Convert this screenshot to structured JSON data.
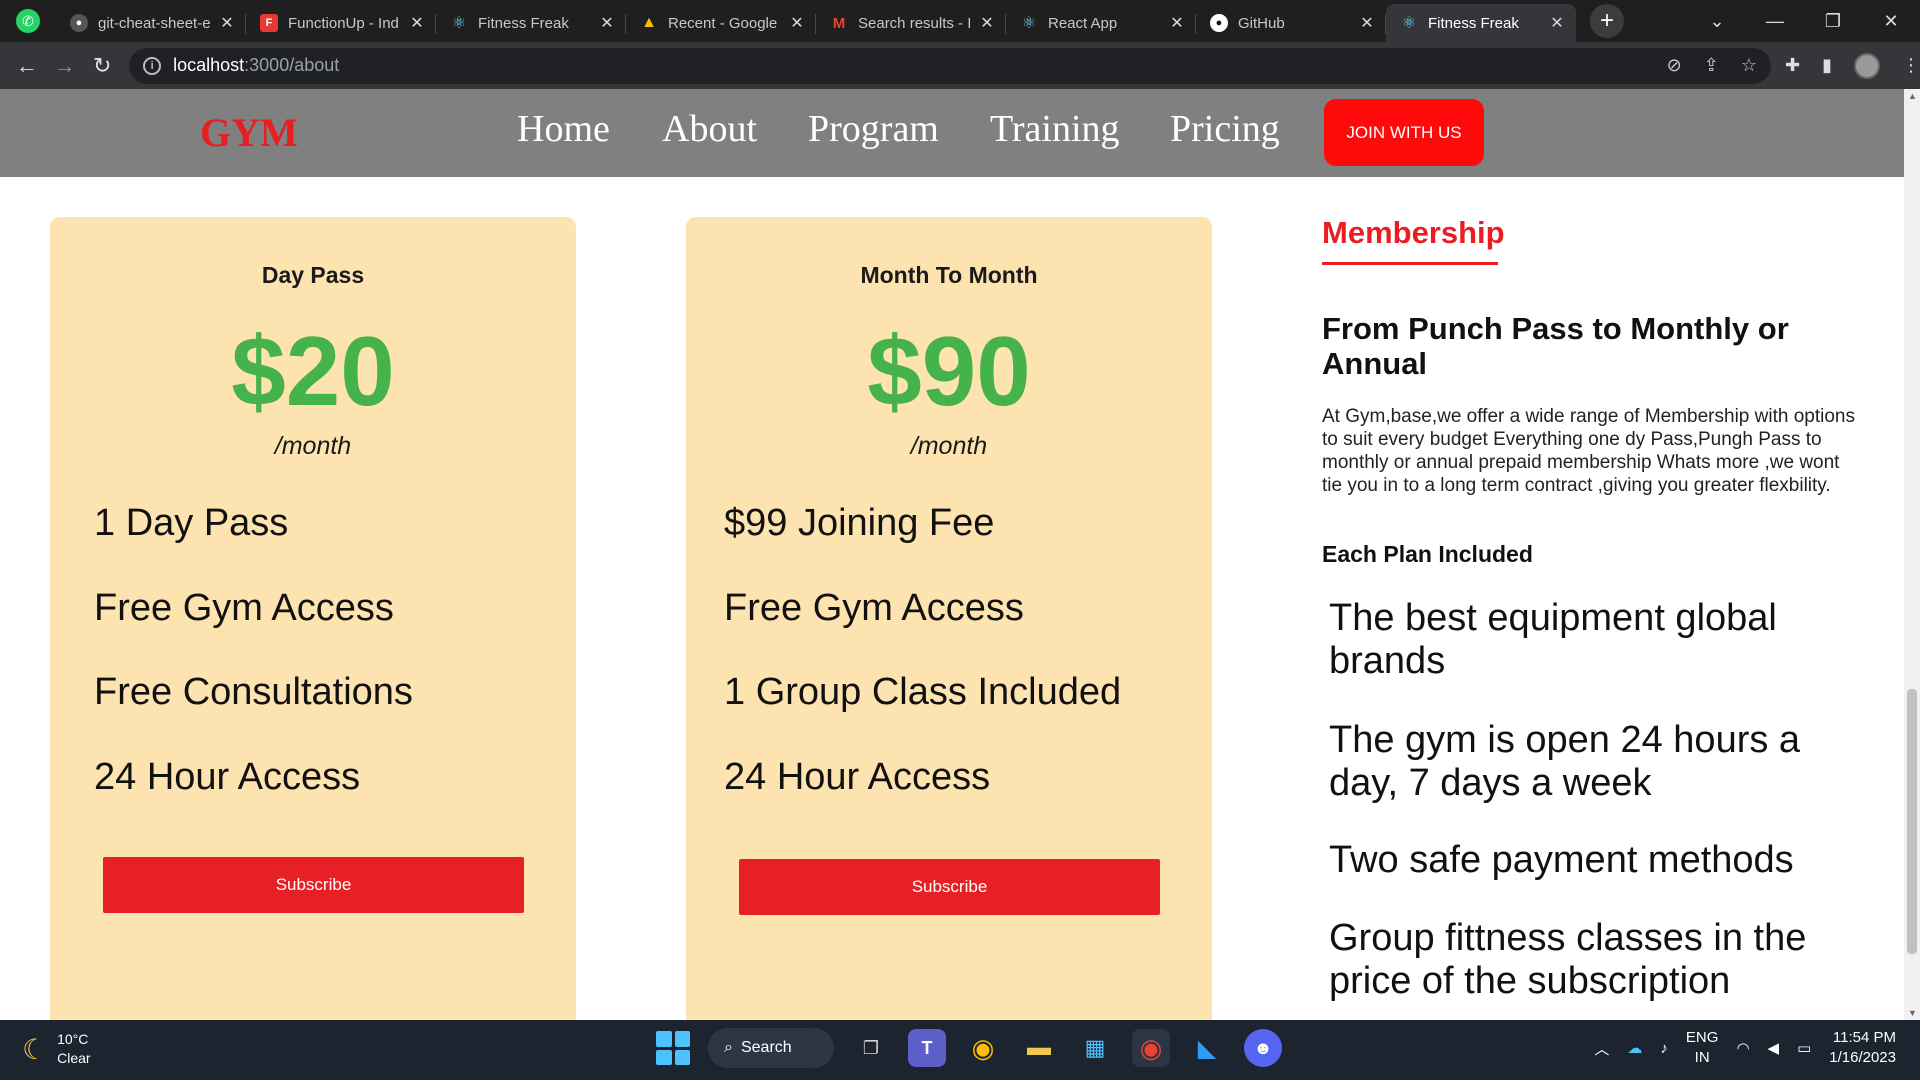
{
  "browser": {
    "tabs": [
      {
        "label": "git-cheat-sheet-e",
        "favicon": "github-icon"
      },
      {
        "label": "FunctionUp - Ind",
        "favicon": "functionup-icon"
      },
      {
        "label": "Fitness Freak",
        "favicon": "react-icon"
      },
      {
        "label": "Recent - Google",
        "favicon": "google-drive-icon"
      },
      {
        "label": "Search results - I",
        "favicon": "gmail-icon"
      },
      {
        "label": "React App",
        "favicon": "react-icon"
      },
      {
        "label": "GitHub",
        "favicon": "github-icon"
      },
      {
        "label": "Fitness Freak",
        "favicon": "react-icon",
        "active": true
      }
    ],
    "url_host": "localhost",
    "url_path": ":3000/about"
  },
  "site": {
    "logo": "GYM",
    "nav": [
      "Home",
      "About",
      "Program",
      "Training",
      "Pricing"
    ],
    "join_label": "JOIN WITH US"
  },
  "cards": [
    {
      "title": "Day Pass",
      "price": "$20",
      "period": "/month",
      "features": [
        "1 Day Pass",
        "Free Gym Access",
        "Free Consultations",
        "24 Hour Access"
      ],
      "button": "Subscribe"
    },
    {
      "title": "Month To Month",
      "price": "$90",
      "period": "/month",
      "features": [
        "$99 Joining Fee",
        "Free Gym Access",
        "1 Group Class Included",
        "24 Hour Access"
      ],
      "button": "Subscribe"
    }
  ],
  "membership": {
    "title": "Membership",
    "heading": "From Punch Pass to Monthly or Annual",
    "description": "At Gym,base,we offer a wide range of Membership with options to suit every budget Everything one dy Pass,Pungh Pass to monthly or annual prepaid membership Whats more ,we wont tie you in to a long term contract ,giving you greater flexbility.",
    "plan_heading": "Each Plan Included",
    "plan_items": [
      "The best equipment global brands",
      "The gym is open 24 hours a day, 7 days a week",
      "Two safe payment methods",
      "Group fittness classes in the price of the subscription"
    ]
  },
  "taskbar": {
    "temperature": "10°C",
    "condition": "Clear",
    "search_label": "Search",
    "lang_top": "ENG",
    "lang_bottom": "IN",
    "time": "11:54 PM",
    "date": "1/16/2023"
  },
  "colors": {
    "accent_red": "#e91e22",
    "price_green": "#45b34a",
    "card_bg": "#fde3b0",
    "nav_bg": "#808080"
  }
}
